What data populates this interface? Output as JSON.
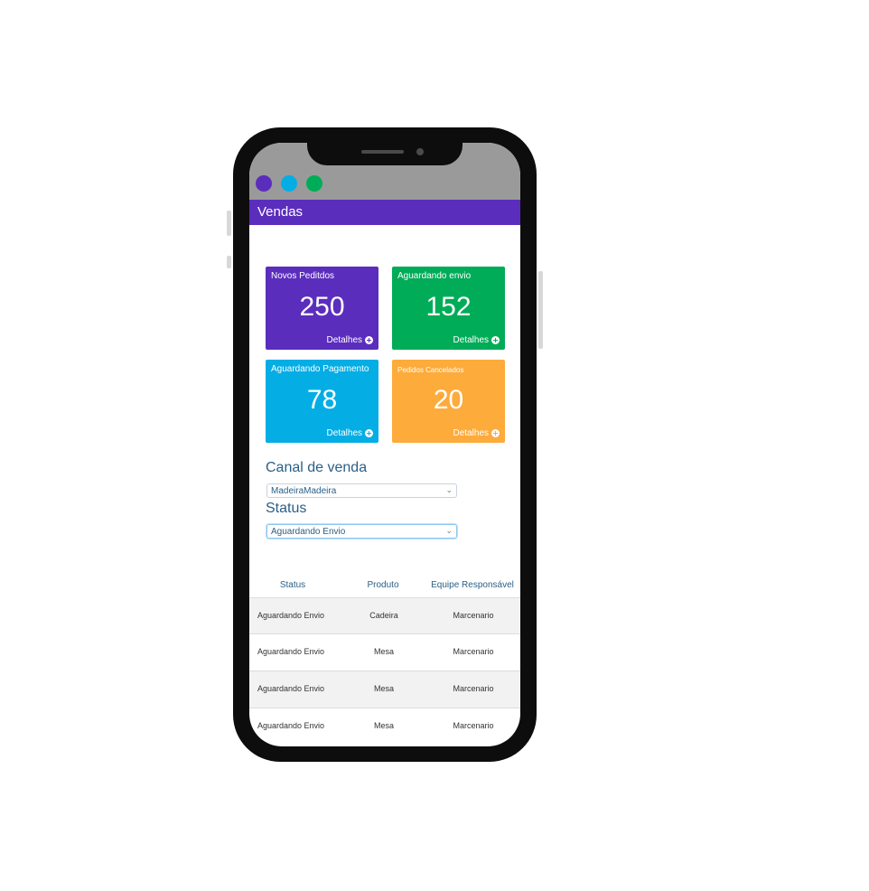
{
  "app": {
    "title": "Vendas"
  },
  "window_dots": [
    {
      "name": "purple",
      "color": "#5b2dbd"
    },
    {
      "name": "blue",
      "color": "#05ade5"
    },
    {
      "name": "green",
      "color": "#01ac58"
    }
  ],
  "cards": [
    {
      "title": "Novos Peditdos",
      "value": "250",
      "details": "Detalhes",
      "color": "#5b2dbd"
    },
    {
      "title": "Aguardando envio",
      "value": "152",
      "details": "Detalhes",
      "color": "#01ac58"
    },
    {
      "title": "Aguardando  Pagamento",
      "value": "78",
      "details": "Detalhes",
      "color": "#05ade5"
    },
    {
      "title": "Pedidos Cancelados",
      "value": "20",
      "details": "Detalhes",
      "color": "#fdab3b"
    }
  ],
  "filters": {
    "channel": {
      "label": "Canal de venda",
      "value": "MadeiraMadeira"
    },
    "status": {
      "label": "Status",
      "value": "Aguardando Envio"
    }
  },
  "table": {
    "headers": [
      "Status",
      "Produto",
      "Equipe Responsável"
    ],
    "rows": [
      [
        "Aguardando Envio",
        "Cadeira",
        "Marcenario"
      ],
      [
        "Aguardando Envio",
        "Mesa",
        "Marcenario"
      ],
      [
        "Aguardando Envio",
        "Mesa",
        "Marcenario"
      ],
      [
        "Aguardando Envio",
        "Mesa",
        "Marcenario"
      ]
    ]
  }
}
